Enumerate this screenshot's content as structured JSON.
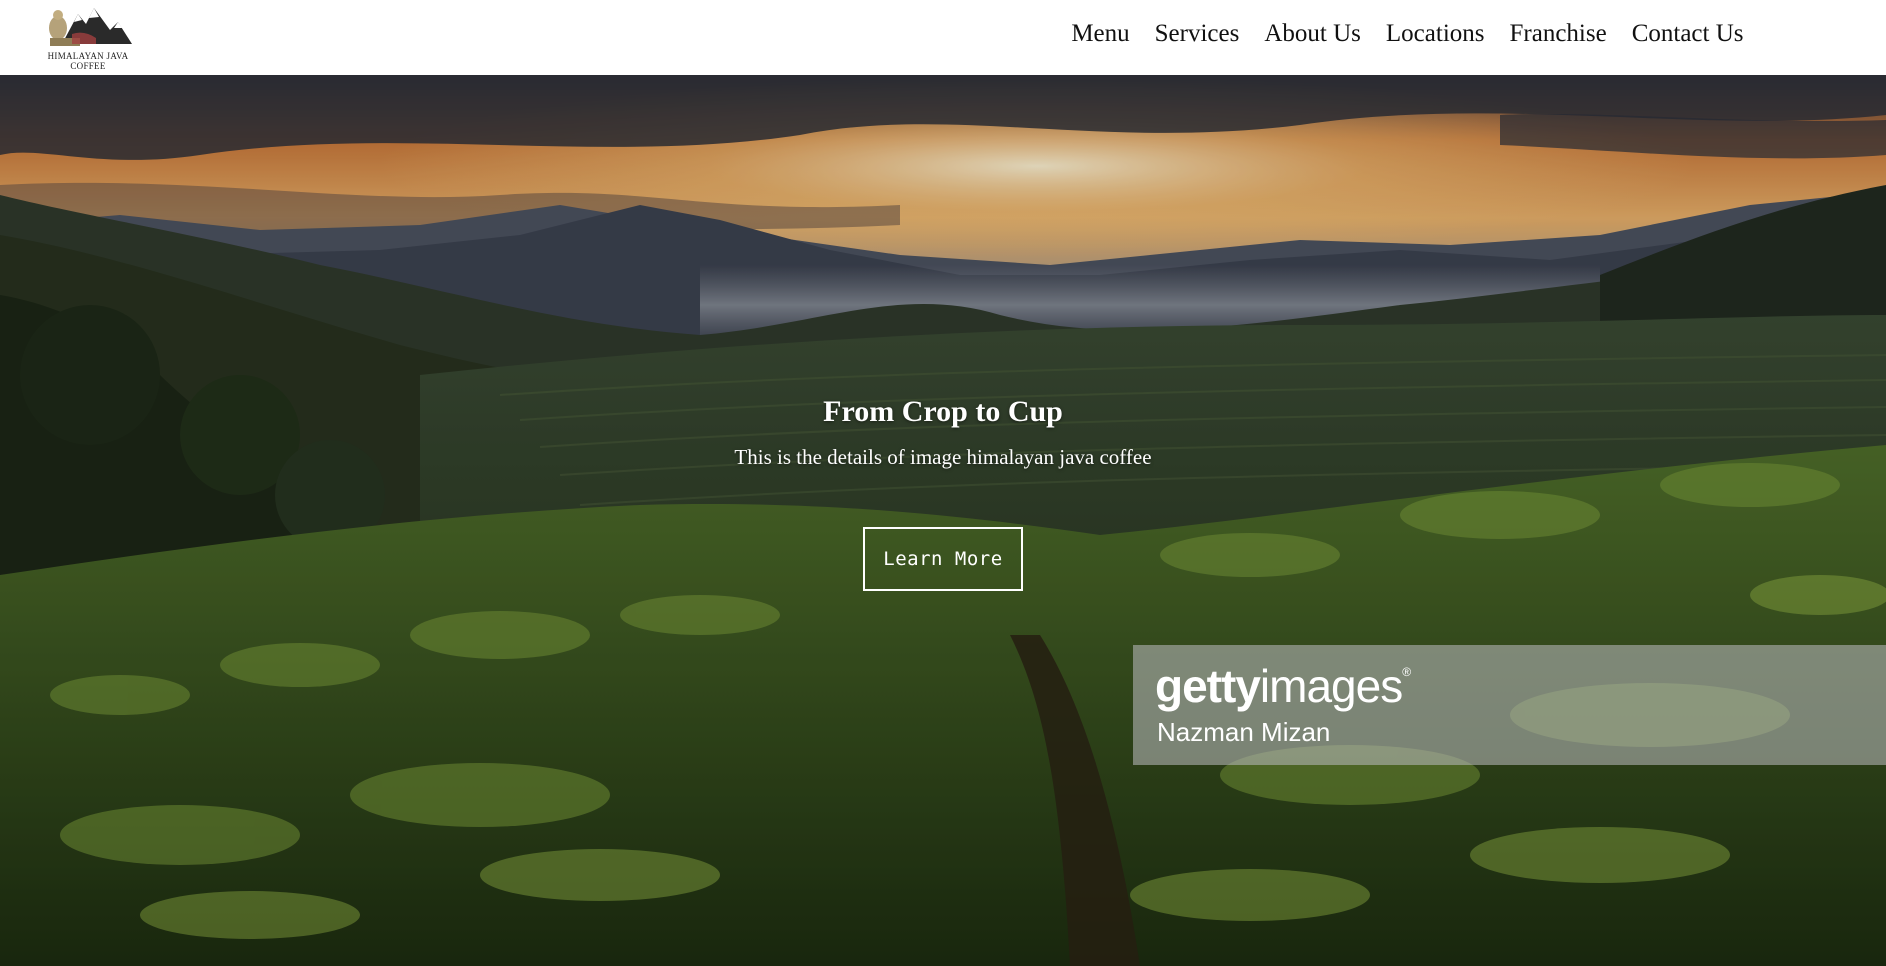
{
  "brand": {
    "line1": "HIMALAYAN JAVA",
    "line2": "COFFEE"
  },
  "nav": {
    "items": [
      {
        "label": "Menu"
      },
      {
        "label": "Services"
      },
      {
        "label": "About Us"
      },
      {
        "label": "Locations"
      },
      {
        "label": "Franchise"
      },
      {
        "label": "Contact Us"
      }
    ]
  },
  "hero": {
    "title": "From Crop to Cup",
    "description": "This is the details of image himalayan java coffee",
    "button_label": "Learn More"
  },
  "watermark": {
    "brand_bold": "getty",
    "brand_light": "images",
    "registered": "®",
    "credit": "Nazman Mizan"
  },
  "colors": {
    "header_bg": "#ffffff",
    "nav_text": "#111111",
    "hero_text": "#ffffff"
  },
  "icons": {
    "logo": "mountain-logo-icon"
  }
}
